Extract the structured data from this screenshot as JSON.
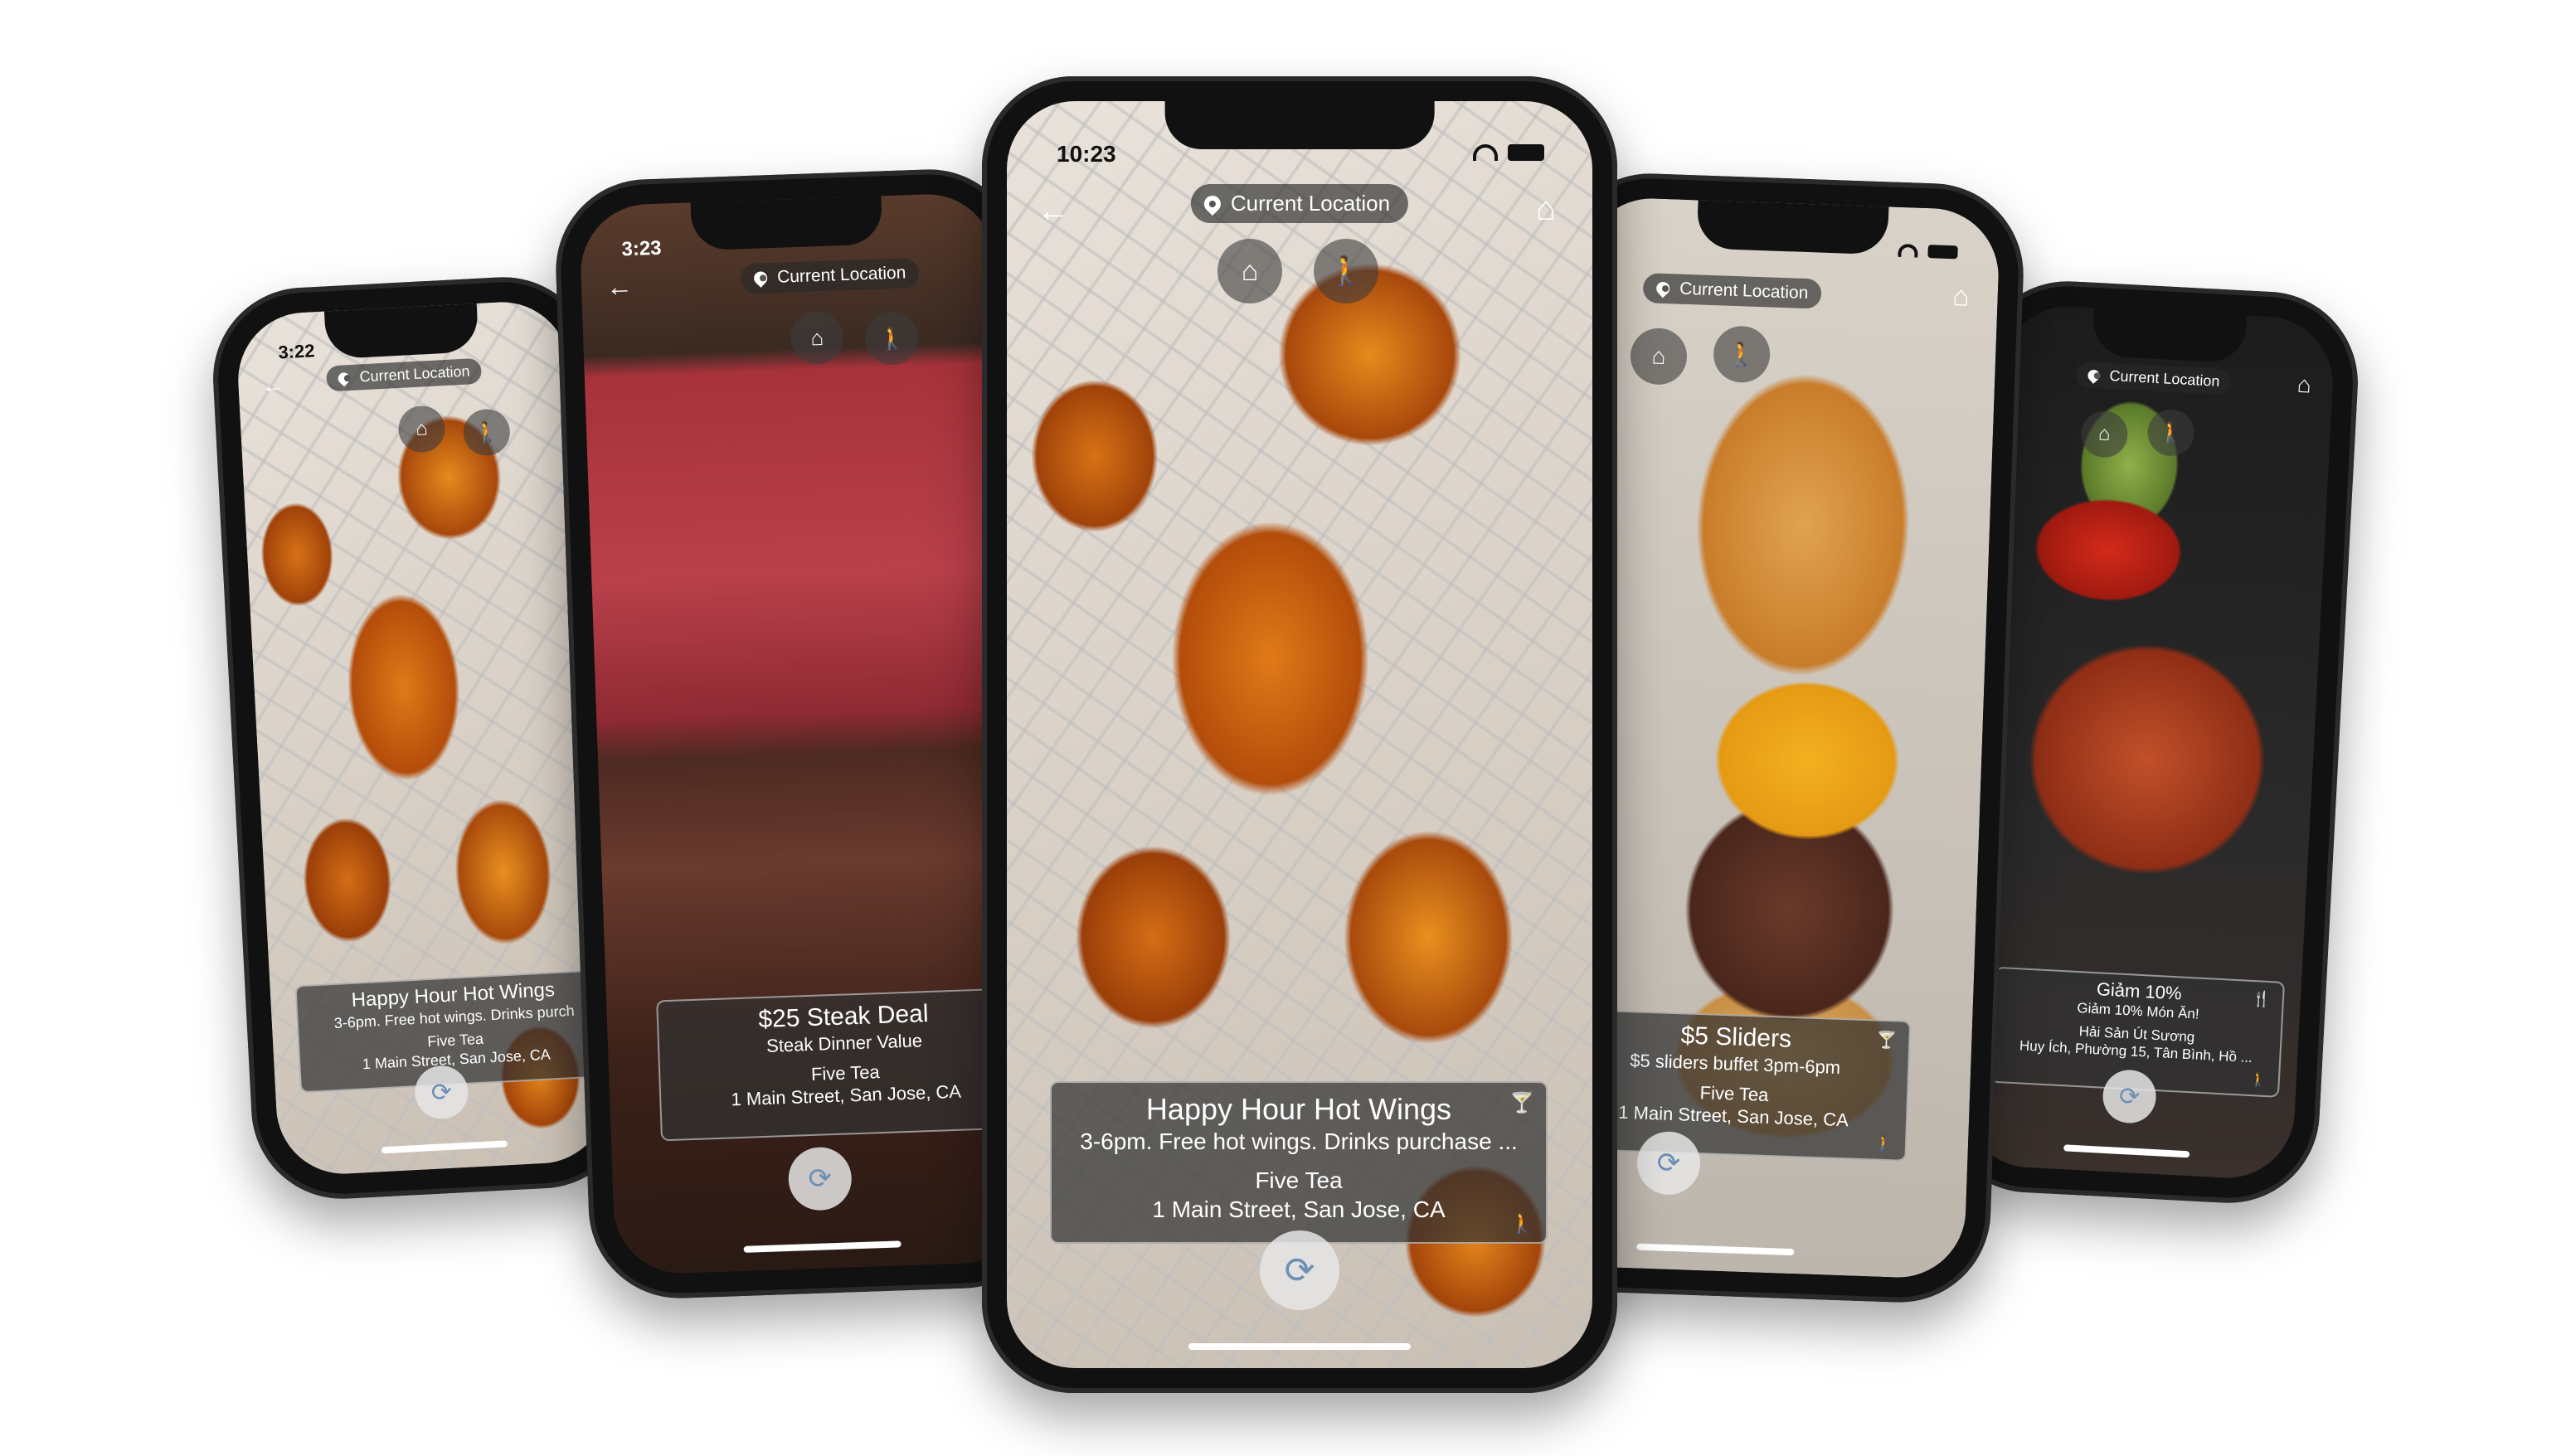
{
  "location_label": "Current Location",
  "icons": {
    "back": "arrow-left-icon",
    "location": "location-pin-icon",
    "tag": "tag-icon",
    "walk": "walking-person-icon",
    "rotate": "rotate-device-icon",
    "drink": "cocktail-glass-icon",
    "dining": "fork-knife-icon"
  },
  "phones": {
    "far_left": {
      "time": "3:22",
      "deal_title": "Happy Hour Hot Wings",
      "deal_desc": "3-6pm. Free hot wings. Drinks purch",
      "venue": "Five Tea",
      "address": "1 Main Street, San Jose, CA"
    },
    "left": {
      "time": "3:23",
      "deal_title": "$25 Steak Deal",
      "deal_desc": "Steak Dinner Value",
      "venue": "Five Tea",
      "address": "1 Main Street, San Jose, CA"
    },
    "center": {
      "time": "10:23",
      "deal_title": "Happy Hour Hot Wings",
      "deal_desc": "3-6pm. Free hot wings. Drinks purchase ...",
      "venue": "Five Tea",
      "address": "1 Main Street, San Jose, CA"
    },
    "right": {
      "deal_title": "$5 Sliders",
      "deal_desc": "$5 sliders buffet 3pm-6pm",
      "venue": "Five Tea",
      "address": "1 Main Street, San Jose, CA"
    },
    "far_right": {
      "deal_title": "Giảm 10%",
      "deal_desc": "Giảm 10% Món Ăn!",
      "venue": "Hải Sản Út Sương",
      "address": "Huy Ích, Phường 15, Tân Bình, Hồ ..."
    }
  }
}
